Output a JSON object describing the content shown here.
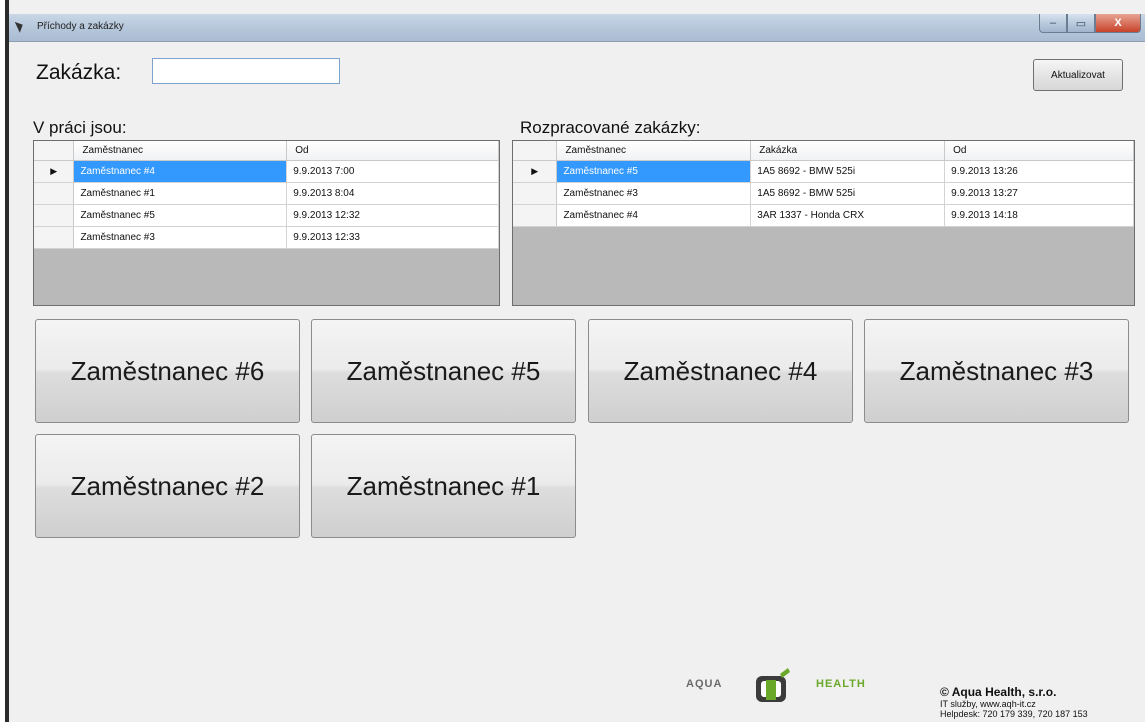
{
  "window": {
    "title": "Příchody a zakázky",
    "controls": {
      "minimize": "–",
      "maximize": "▭",
      "close": "X"
    }
  },
  "order": {
    "label": "Zakázka:",
    "value": ""
  },
  "refresh_button": "Aktualizovat",
  "working": {
    "label": "V práci jsou:",
    "columns": [
      "Zaměstnanec",
      "Od"
    ],
    "rows": [
      [
        "Zaměstnanec #4",
        "9.9.2013 7:00"
      ],
      [
        "Zaměstnanec #1",
        "9.9.2013 8:04"
      ],
      [
        "Zaměstnanec #5",
        "9.9.2013 12:32"
      ],
      [
        "Zaměstnanec #3",
        "9.9.2013 12:33"
      ]
    ]
  },
  "orders_in_progress": {
    "label": "Rozpracované zakázky:",
    "columns": [
      "Zaměstnanec",
      "Zakázka",
      "Od"
    ],
    "rows": [
      [
        "Zaměstnanec #5",
        "1A5 8692 - BMW 525i",
        "9.9.2013 13:26"
      ],
      [
        "Zaměstnanec #3",
        "1A5 8692 - BMW 525i",
        "9.9.2013 13:27"
      ],
      [
        "Zaměstnanec #4",
        "3AR 1337 - Honda CRX",
        "9.9.2013 14:18"
      ]
    ]
  },
  "current_row_indicator": "▶",
  "employee_buttons": [
    "Zaměstnanec #6",
    "Zaměstnanec #5",
    "Zaměstnanec #4",
    "Zaměstnanec #3",
    "Zaměstnanec #2",
    "Zaměstnanec #1"
  ],
  "footer": {
    "logo_left": "AQUA",
    "logo_right": "HEALTH",
    "company": "© Aqua Health, s.r.o.",
    "line1": "IT služby, www.aqh-it.cz",
    "line2": "Helpdesk: 720 179 339, 720 187 153"
  },
  "colors": {
    "selection": "#3399ff",
    "logo_green": "#6aa82a",
    "input_border": "#7da2ce"
  }
}
